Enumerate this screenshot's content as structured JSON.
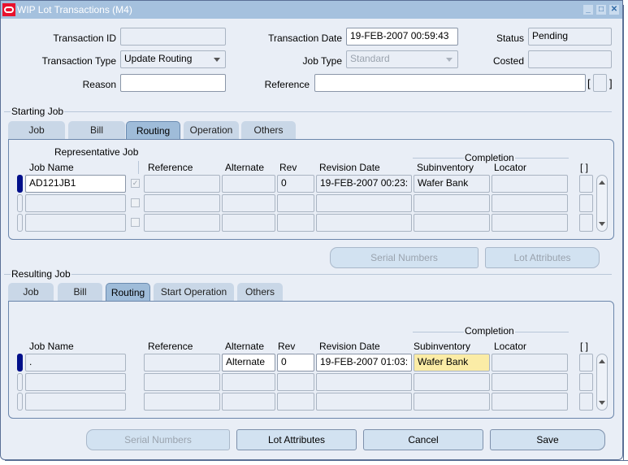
{
  "window": {
    "title": "WIP Lot Transactions (M4)",
    "controls": [
      "minimize-icon",
      "maximize-icon",
      "close-icon"
    ]
  },
  "header": {
    "transaction_id": {
      "label": "Transaction ID",
      "value": ""
    },
    "transaction_type": {
      "label": "Transaction Type",
      "value": "Update Routing"
    },
    "reason": {
      "label": "Reason",
      "value": ""
    },
    "transaction_date": {
      "label": "Transaction Date",
      "value": "19-FEB-2007 00:59:43"
    },
    "job_type": {
      "label": "Job Type",
      "value": "Standard"
    },
    "reference": {
      "label": "Reference",
      "value": ""
    },
    "status": {
      "label": "Status",
      "value": "Pending"
    },
    "costed": {
      "label": "Costed",
      "value": ""
    },
    "dff_bracket_open": "[",
    "dff_bracket_close": "]"
  },
  "starting_job": {
    "title": "Starting Job",
    "tabs": [
      "Job",
      "Bill",
      "Routing",
      "Operation",
      "Others"
    ],
    "active_tab": "Routing",
    "columns": {
      "group_rep": "Representative Job",
      "job_name": "Job Name",
      "reference": "Reference",
      "alternate": "Alternate",
      "rev": "Rev",
      "revision_date": "Revision Date",
      "completion_group": "Completion",
      "subinventory": "Subinventory",
      "locator": "Locator",
      "dff": "[ ]"
    },
    "rows": [
      {
        "job_name": "AD121JB1",
        "representative": true,
        "reference": "",
        "alternate": "",
        "rev": "0",
        "revision_date": "19-FEB-2007 00:23:",
        "subinventory": "Wafer Bank",
        "locator": ""
      },
      {
        "job_name": "",
        "representative": false,
        "reference": "",
        "alternate": "",
        "rev": "",
        "revision_date": "",
        "subinventory": "",
        "locator": ""
      },
      {
        "job_name": "",
        "representative": false,
        "reference": "",
        "alternate": "",
        "rev": "",
        "revision_date": "",
        "subinventory": "",
        "locator": ""
      }
    ],
    "buttons": {
      "serial_numbers": "Serial Numbers",
      "lot_attributes": "Lot Attributes"
    }
  },
  "resulting_job": {
    "title": "Resulting Job",
    "tabs": [
      "Job",
      "Bill",
      "Routing",
      "Start Operation",
      "Others"
    ],
    "active_tab": "Routing",
    "columns": {
      "job_name": "Job Name",
      "reference": "Reference",
      "alternate": "Alternate",
      "rev": "Rev",
      "revision_date": "Revision Date",
      "completion_group": "Completion",
      "subinventory": "Subinventory",
      "locator": "Locator",
      "dff": "[ ]"
    },
    "rows": [
      {
        "job_name": ".",
        "reference": "",
        "alternate": "Alternate",
        "rev": "0",
        "revision_date": "19-FEB-2007 01:03:",
        "subinventory": "Wafer Bank",
        "locator": ""
      },
      {
        "job_name": "",
        "reference": "",
        "alternate": "",
        "rev": "",
        "revision_date": "",
        "subinventory": "",
        "locator": ""
      },
      {
        "job_name": "",
        "reference": "",
        "alternate": "",
        "rev": "",
        "revision_date": "",
        "subinventory": "",
        "locator": ""
      }
    ]
  },
  "footer": {
    "serial_numbers": "Serial Numbers",
    "lot_attributes": "Lot Attributes",
    "cancel": "Cancel",
    "save": "Save"
  },
  "colors": {
    "titlebar": "#a5c1de",
    "background": "#e9eef6",
    "current_row": "#000f8a",
    "required_field": "#fbeca6",
    "button": "#d2e2f1"
  }
}
